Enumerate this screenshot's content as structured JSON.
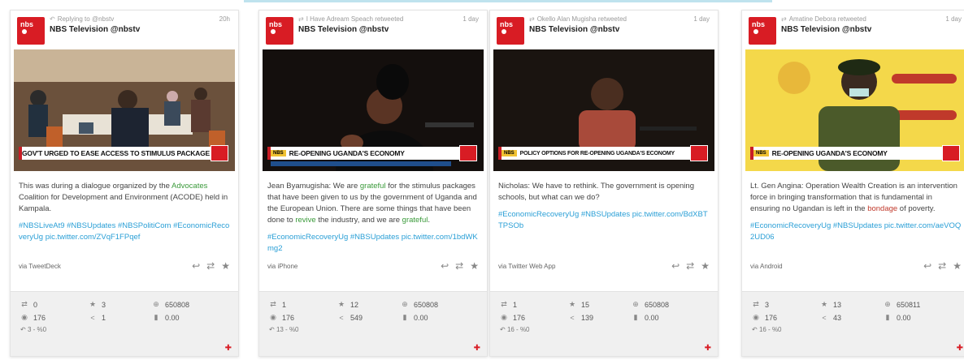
{
  "cards": [
    {
      "retweet_line": "Replying to @nbstv",
      "time": "20h",
      "author": "NBS Television @nbstv",
      "lower_third_text": "GOV'T URGED TO EASE ACCESS TO STIMULUS PACKAGE",
      "body_parts": [
        "This was during a dialogue organized by the ",
        "Advocates",
        " Coalition for Development and Environment (ACODE) held in Kampala."
      ],
      "hashtags": "#NBSLiveAt9 #NBSUpdates #NBSPolitiCom #EconomicRecoveryUg pic.twitter.com/ZVqF1FPqef",
      "via": "via TweetDeck",
      "stats": {
        "retweets": "0",
        "likes": "3",
        "followers": "650808",
        "views": "176",
        "shares": "1",
        "ratio": "0.00",
        "extra": "3 - %0"
      }
    },
    {
      "retweet_line": "I Have Adream Speach retweeted",
      "time": "1 day",
      "author": "NBS Television @nbstv",
      "lower_third_text": "RE-OPENING UGANDA'S ECONOMY",
      "body_parts": [
        "Jean Byamugisha: We are ",
        "grateful",
        " for the stimulus packages that have been given to us by the government of Uganda and the European Union. There are some things that have been done to ",
        "revive",
        " the industry, and we are ",
        "grateful",
        "."
      ],
      "hashtags": "#EconomicRecoveryUg #NBSUpdates pic.twitter.com/1bdWKmg2",
      "via": "via iPhone",
      "stats": {
        "retweets": "1",
        "likes": "12",
        "followers": "650808",
        "views": "176",
        "shares": "549",
        "ratio": "0.00",
        "extra": "13 - %0"
      }
    },
    {
      "retweet_line": "Okello Alan Mugisha retweeted",
      "time": "1 day",
      "author": "NBS Television @nbstv",
      "lower_third_text": "POLICY OPTIONS FOR RE-OPENING UGANDA'S ECONOMY",
      "body_parts": [
        "Nicholas: We have to rethink. The government is opening schools, but what can we do?"
      ],
      "hashtags": "#EconomicRecoveryUg #NBSUpdates pic.twitter.com/BdXBTTPSOb",
      "via": "via Twitter Web App",
      "stats": {
        "retweets": "1",
        "likes": "15",
        "followers": "650808",
        "views": "176",
        "shares": "139",
        "ratio": "0.00",
        "extra": "16 - %0"
      }
    },
    {
      "retweet_line": "Amatine Debora retweeted",
      "time": "1 day",
      "author": "NBS Television @nbstv",
      "lower_third_text": "RE-OPENING UGANDA'S ECONOMY",
      "body_parts": [
        "Lt. Gen Angina: Operation Wealth Creation is an intervention force in bringing transformation that is fundamental in ensuring no Ugandan is left in the ",
        "bondage",
        " of poverty."
      ],
      "hashtags": "#EconomicRecoveryUg #NBSUpdates pic.twitter.com/aeVOQ2UD06",
      "via": "via Android",
      "stats": {
        "retweets": "3",
        "likes": "13",
        "followers": "650811",
        "views": "176",
        "shares": "43",
        "ratio": "0.00",
        "extra": "16 - %0"
      }
    }
  ],
  "logo_text": "nbs",
  "lt_tag": "NBS",
  "icons": {
    "retweet": "retweet-icon",
    "like": "star-icon",
    "reply": "reply-icon",
    "followers": "globe-icon",
    "views": "eye-icon",
    "shares": "share-icon",
    "ratio": "bar-chart-icon",
    "flag": "flag-icon"
  },
  "colors": {
    "brand": "#d81c24",
    "link": "#2a9fd6",
    "highlight": "#3a9a3a"
  }
}
